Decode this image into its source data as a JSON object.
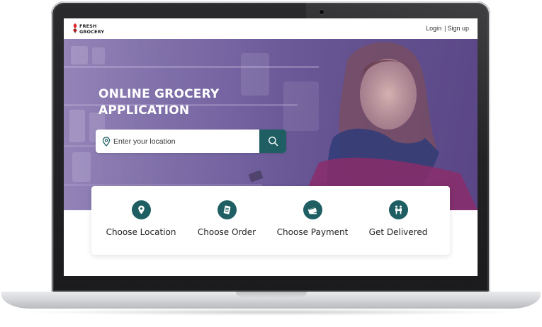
{
  "brand": {
    "name_line1": "FRESH",
    "name_line2": "GROCERY"
  },
  "nav": {
    "login": "Login",
    "separator": "|",
    "signup": "Sign up"
  },
  "hero": {
    "title_line1": "ONLINE GROCERY",
    "title_line2": "APPLICATION",
    "search": {
      "placeholder": "Enter your location",
      "value": ""
    }
  },
  "steps": [
    {
      "label": "Choose Location",
      "icon": "location-pin-icon"
    },
    {
      "label": "Choose Order",
      "icon": "order-list-icon"
    },
    {
      "label": "Choose Payment",
      "icon": "credit-card-icon"
    },
    {
      "label": "Get Delivered",
      "icon": "delivery-people-icon"
    }
  ],
  "colors": {
    "accent": "#1f5f63",
    "hero_overlay": "#6b5a98",
    "logo_red": "#e02424"
  }
}
